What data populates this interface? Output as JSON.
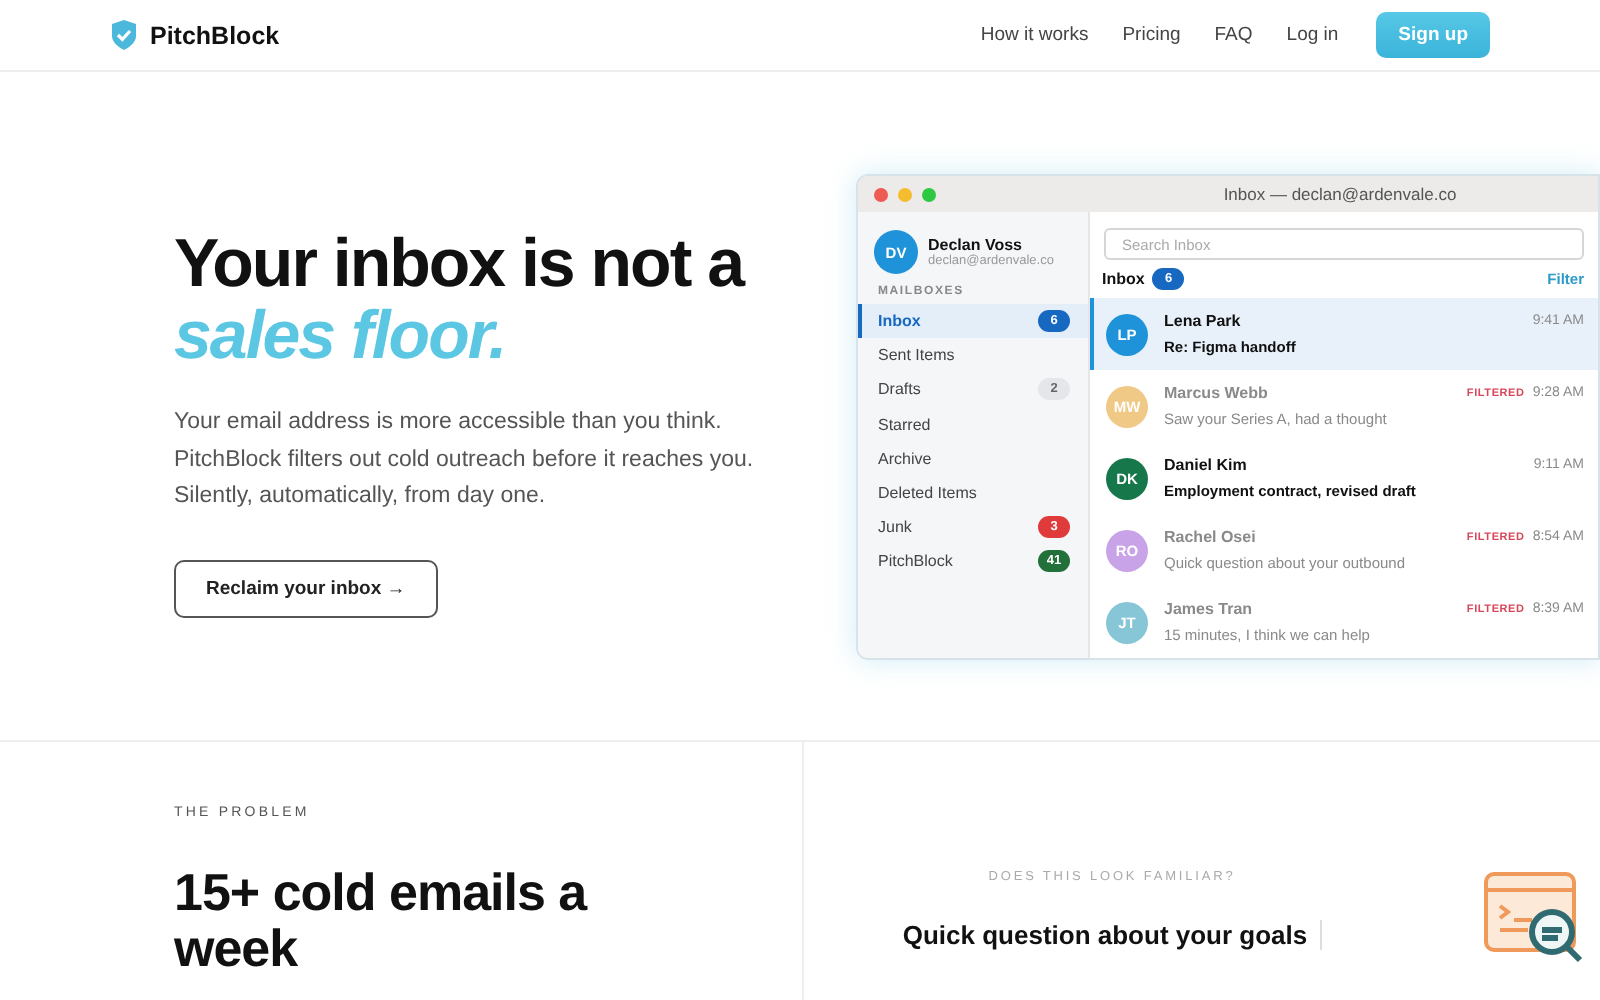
{
  "nav": {
    "brand": "PitchBlock",
    "links": [
      "How it works",
      "Pricing",
      "FAQ",
      "Log in"
    ],
    "cta": "Sign up"
  },
  "hero": {
    "title_line": "Your inbox is not a",
    "title_accent": "sales floor.",
    "body": "Your email address is more accessible than you think. PitchBlock filters out cold outreach before it reaches you. Silently, automatically, from day one.",
    "button": "Reclaim your inbox →"
  },
  "mail_window": {
    "title": "Inbox — declan@ardenvale.co",
    "account": {
      "initials": "DV",
      "name": "Declan Voss",
      "email": "declan@ardenvale.co",
      "color": "#1f93d9"
    },
    "mailboxes_heading": "MAILBOXES",
    "mailboxes": [
      {
        "label": "Inbox",
        "count": "6",
        "color": "#1668c1",
        "selected": true
      },
      {
        "label": "Sent Items",
        "selected": false
      },
      {
        "label": "Drafts",
        "count": "2",
        "color": "#e4e6ea",
        "selected": false
      },
      {
        "label": "Starred",
        "selected": false
      },
      {
        "label": "Archive",
        "selected": false
      },
      {
        "label": "Deleted Items",
        "selected": false
      },
      {
        "label": "Junk",
        "count": "3",
        "color": "#e03b3b",
        "selected": false
      },
      {
        "label": "PitchBlock",
        "count": "41",
        "color": "#22703a",
        "selected": false
      }
    ],
    "search": {
      "placeholder": "Search Inbox"
    },
    "list_title": "Inbox",
    "list_count": "6",
    "filter": "Filter",
    "messages": [
      {
        "initials": "LP",
        "color": "#1f93d9",
        "sender": "Lena Park",
        "subject": "Re: Figma handoff",
        "time": "9:41 AM",
        "filtered": false,
        "selected": true
      },
      {
        "initials": "MW",
        "color": "#f0c987",
        "sender": "Marcus Webb",
        "subject": "Saw your Series A, had a thought",
        "time": "9:28 AM",
        "tag": "FILTERED",
        "filtered": true,
        "selected": false
      },
      {
        "initials": "DK",
        "color": "#16784a",
        "sender": "Daniel Kim",
        "subject": "Employment contract, revised draft",
        "time": "9:11 AM",
        "filtered": false,
        "selected": false
      },
      {
        "initials": "RO",
        "color": "#c9a3e8",
        "sender": "Rachel Osei",
        "subject": "Quick question about your outbound",
        "time": "8:54 AM",
        "tag": "FILTERED",
        "filtered": true,
        "selected": false
      },
      {
        "initials": "JT",
        "color": "#86c6d6",
        "sender": "James Tran",
        "subject": "15 minutes, I think we can help",
        "time": "8:39 AM",
        "tag": "FILTERED",
        "filtered": true,
        "selected": false
      }
    ]
  },
  "problem": {
    "eyebrow": "THE PROBLEM",
    "title": "15+ cold emails a week",
    "side_eyebrow": "DOES THIS LOOK FAMILIAR?",
    "side_subject": "Quick question about your goals"
  }
}
